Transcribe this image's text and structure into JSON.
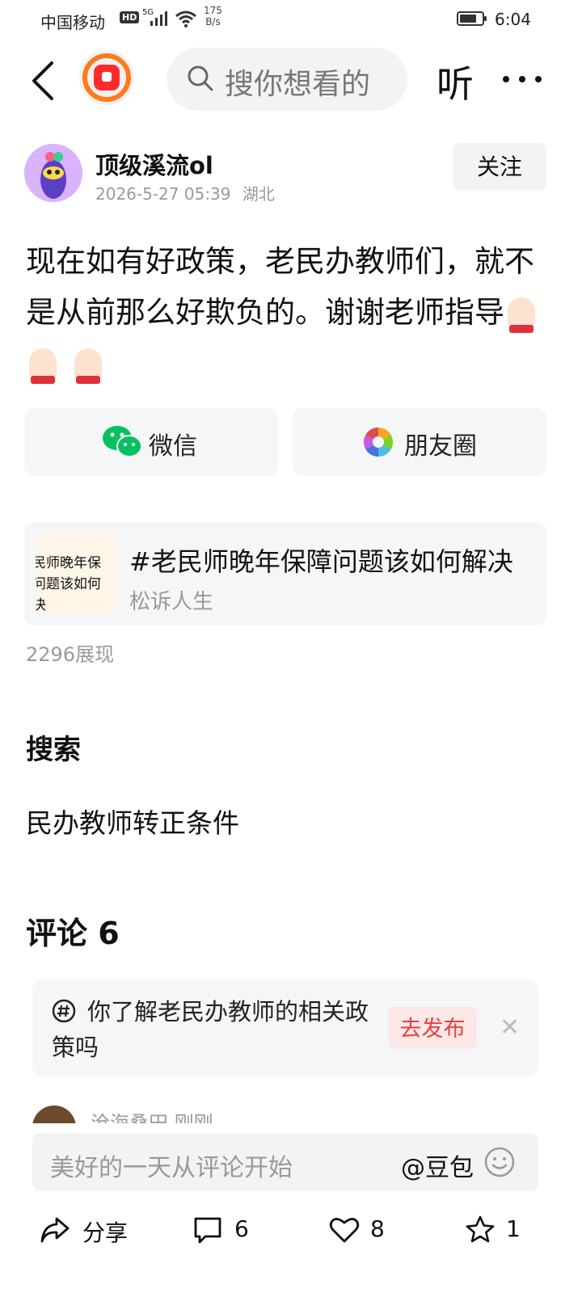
{
  "status_bar": {
    "carrier": "中国移动",
    "hd": "HD",
    "network": "5G",
    "speed_value": "175",
    "speed_unit": "B/s",
    "time": "6:04"
  },
  "nav": {
    "search_placeholder": "搜你想看的",
    "listen_label": "听"
  },
  "author": {
    "name": "顶级溪流ol",
    "timestamp": "2026-5-27 05:39",
    "location": "湖北",
    "follow_label": "关注"
  },
  "post": {
    "text": "现在如有好政策，老民办教师们，就不是从前那么好欺负的。谢谢老师指导",
    "emoji_count": 3
  },
  "share": {
    "wechat_label": "微信",
    "moments_label": "朋友圈"
  },
  "topic_card": {
    "thumb_line1": "民师晚年保",
    "thumb_line2": "问题该如何",
    "thumb_line3": "决",
    "title": "#老民师晚年保障问题该如何解决",
    "author": "松诉人生"
  },
  "views": "2296展现",
  "search_section": {
    "heading": "搜索",
    "term": "民办教师转正条件"
  },
  "comments": {
    "heading": "评论 6",
    "prompt_question": "你了解老民办教师的相关政策吗",
    "publish_label": "去发布",
    "peek_name": "沧海桑田  刚刚"
  },
  "input": {
    "placeholder": "美好的一天从评论开始",
    "mention": "@豆包"
  },
  "toolbar": {
    "share_label": "分享",
    "comment_count": "6",
    "like_count": "8",
    "fav_count": "1"
  },
  "colors": {
    "accent_red": "#e8413c",
    "logo_orange": "#ff7a1a",
    "muted_text": "#999999",
    "card_bg": "#f5f6f7"
  }
}
